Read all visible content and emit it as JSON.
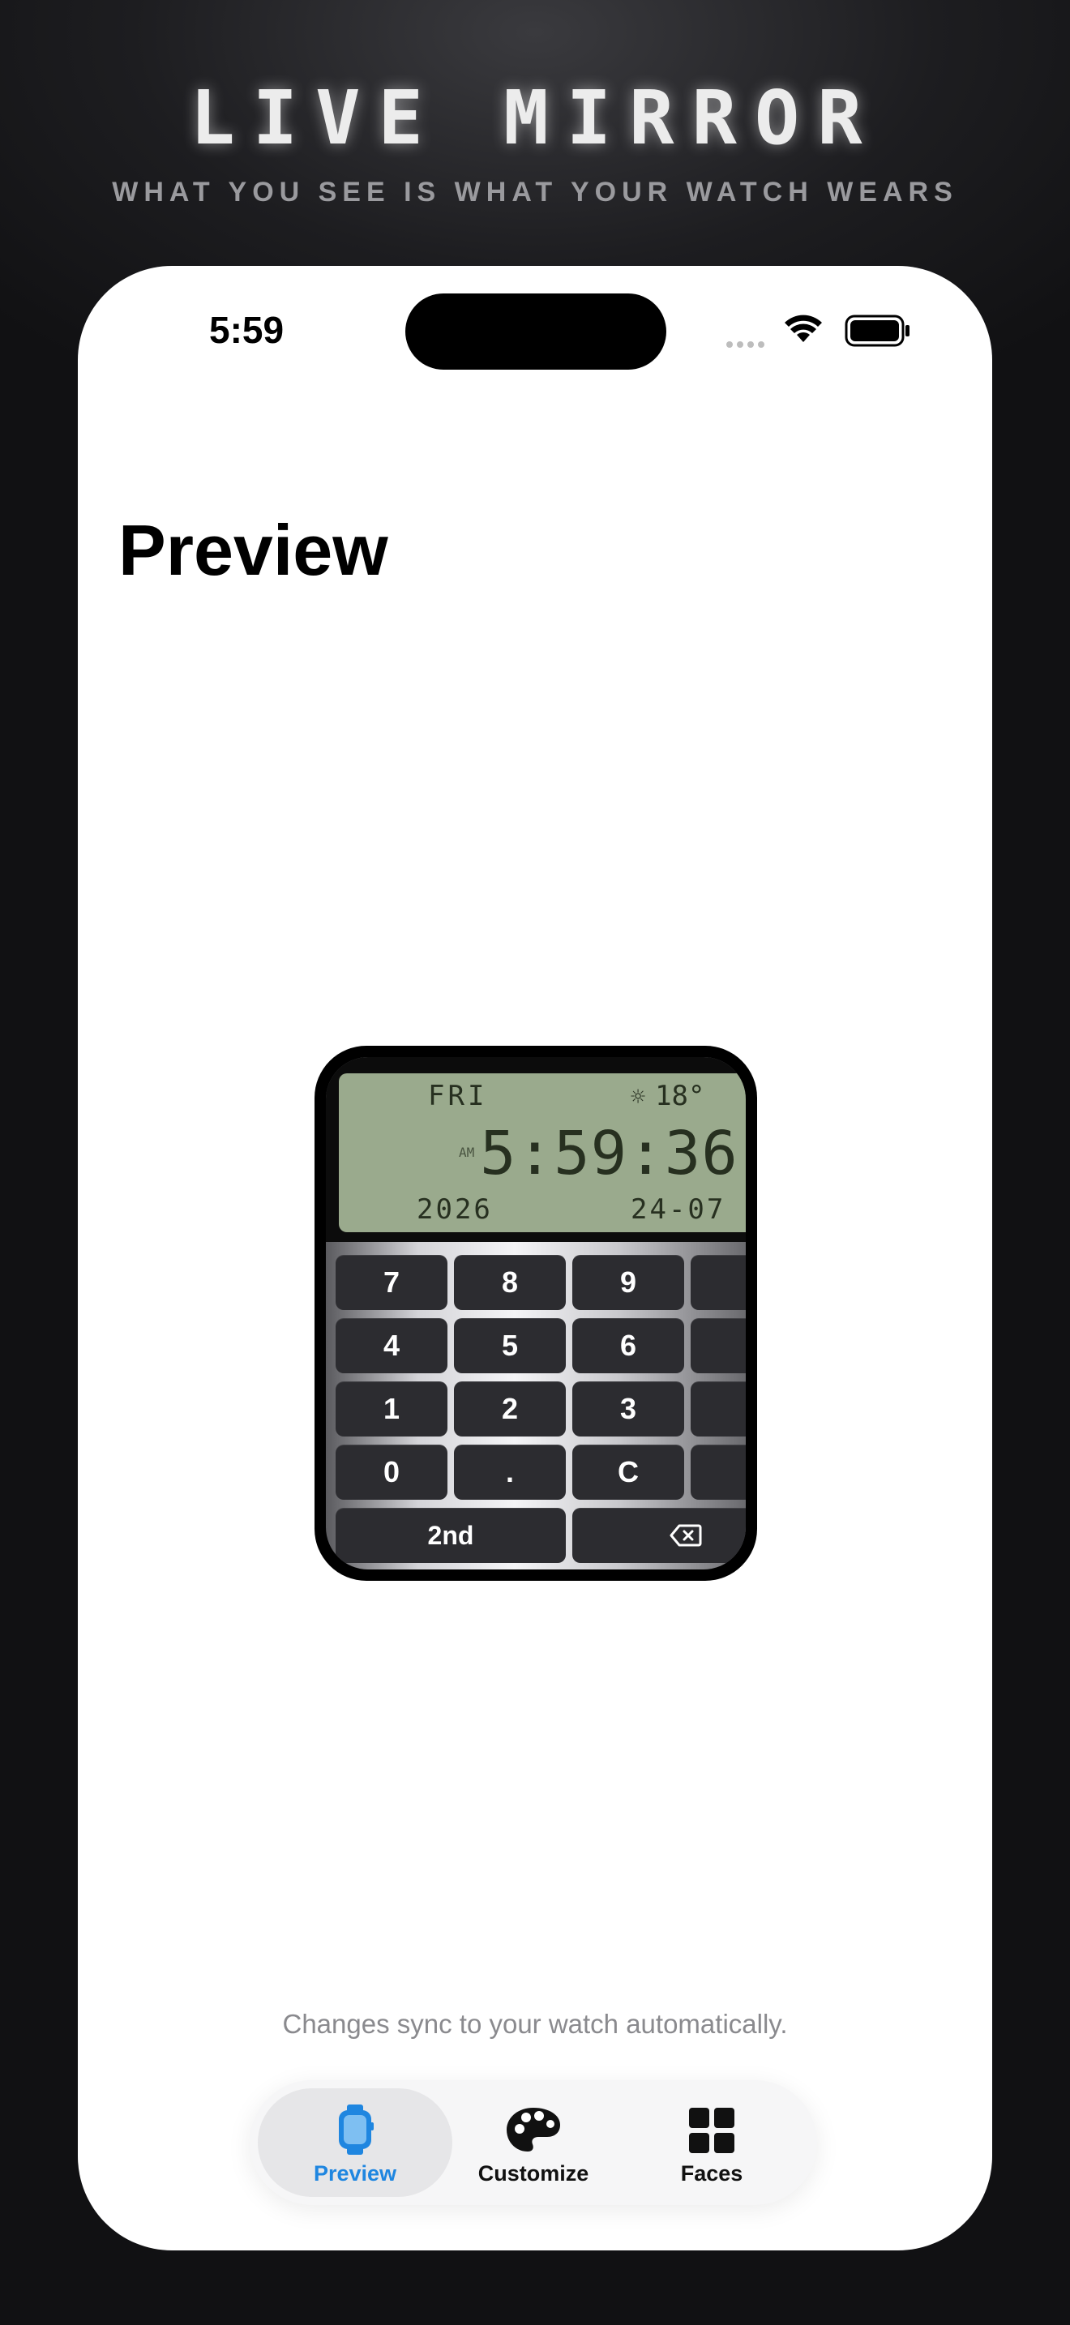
{
  "hero": {
    "title": "LIVE MIRROR",
    "subtitle": "WHAT YOU SEE IS WHAT YOUR WATCH WEARS"
  },
  "status_bar": {
    "time": "5:59"
  },
  "page": {
    "title": "Preview"
  },
  "watch_face": {
    "day": "FRI",
    "weather_icon": "sun-icon",
    "temperature": "18°",
    "ampm": "AM",
    "time": "5:59:36",
    "year": "2026",
    "date": "24-07",
    "keys": {
      "k7": "7",
      "k8": "8",
      "k9": "9",
      "k4": "4",
      "k5": "5",
      "k6": "6",
      "k1": "1",
      "k2": "2",
      "k3": "3",
      "k0": "0",
      "dot": ".",
      "clear": "C",
      "second": "2nd",
      "backspace_icon": "backspace-icon"
    }
  },
  "footer": {
    "sync_note": "Changes sync to your watch automatically."
  },
  "tabbar": {
    "active_color": "#1f86e0",
    "tabs": [
      {
        "label": "Preview",
        "icon": "watch-icon"
      },
      {
        "label": "Customize",
        "icon": "palette-icon"
      },
      {
        "label": "Faces",
        "icon": "grid-icon"
      }
    ]
  }
}
